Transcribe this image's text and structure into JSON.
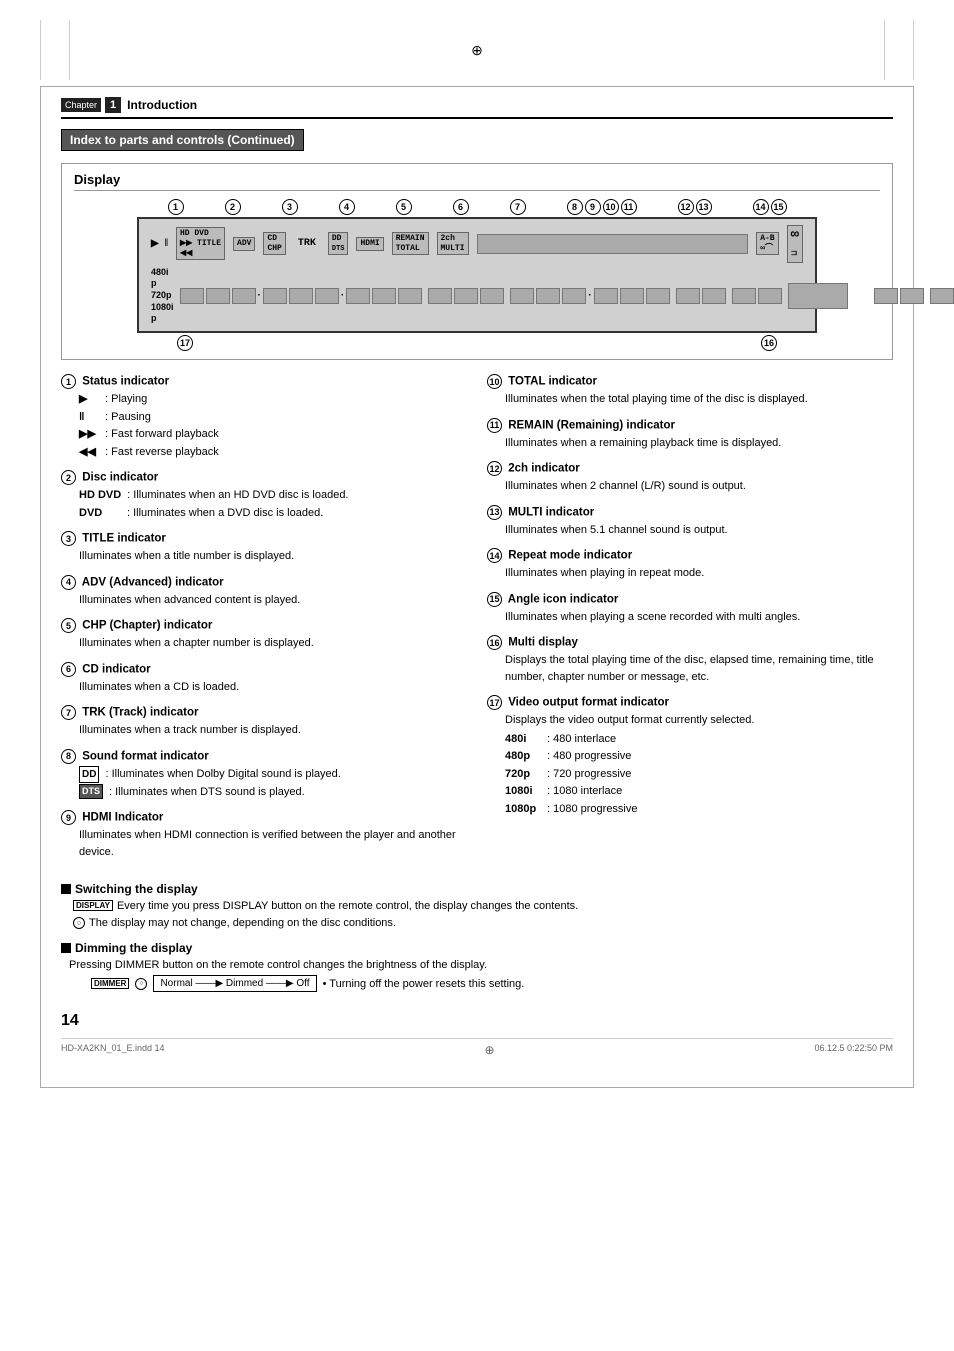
{
  "chapter": {
    "label": "Chapter",
    "number": "1",
    "title": "Introduction"
  },
  "section_title": "Index to parts and controls (Continued)",
  "display_section": {
    "title": "Display",
    "panel": {
      "circled_numbers_top": [
        "①",
        "②",
        "③",
        "④",
        "⑤",
        "⑥",
        "⑦",
        "⑧",
        "⑨",
        "⑩",
        "⑪",
        "⑫",
        "⑬",
        "⑭",
        "⑮"
      ],
      "circled_numbers_bottom": [
        "⑰",
        "⑯"
      ],
      "labels_row1": [
        "▶ ‖  HD DVD",
        "ADV",
        "CD",
        "HDMI  REMAIN",
        "2ch",
        "A-B"
      ],
      "labels_row2": [
        "▶▶   TITLE",
        "",
        "CHP  TRK",
        "DTS  TOTAL  MULTI",
        "",
        "∞"
      ],
      "res_labels": [
        "480i p",
        "720p",
        "1080i p"
      ]
    }
  },
  "indicators": {
    "left": [
      {
        "num": "①",
        "title": "Status indicator",
        "items": [
          {
            "sym": "▶",
            "desc": ": Playing"
          },
          {
            "sym": "‖",
            "desc": ": Pausing"
          },
          {
            "sym": "▶▶",
            "desc": ": Fast forward playback"
          },
          {
            "sym": "◀◀",
            "desc": ": Fast reverse playback"
          }
        ]
      },
      {
        "num": "②",
        "title": "Disc indicator",
        "items": [
          {
            "sym": "HD DVD",
            "desc": ": Illuminates when an HD DVD disc is loaded."
          },
          {
            "sym": "DVD",
            "desc": ": Illuminates when a DVD disc is loaded."
          }
        ]
      },
      {
        "num": "③",
        "title": "TITLE indicator",
        "desc": "Illuminates when a title number is displayed."
      },
      {
        "num": "④",
        "title": "ADV (Advanced) indicator",
        "desc": "Illuminates when advanced content is played."
      },
      {
        "num": "⑤",
        "title": "CHP (Chapter) indicator",
        "desc": "Illuminates when a chapter number is displayed."
      },
      {
        "num": "⑥",
        "title": "CD indicator",
        "desc": "Illuminates when a CD is loaded."
      },
      {
        "num": "⑦",
        "title": "TRK (Track) indicator",
        "desc": "Illuminates when a track number is displayed."
      },
      {
        "num": "⑧",
        "title": "Sound format indicator",
        "items": [
          {
            "sym": "DD",
            "desc": ": Illuminates when Dolby Digital sound is played."
          },
          {
            "sym": "DTS",
            "desc": ": Illuminates when DTS sound is played."
          }
        ]
      },
      {
        "num": "⑨",
        "title": "HDMI Indicator",
        "desc": "Illuminates when HDMI connection is verified between the player and another device."
      }
    ],
    "right": [
      {
        "num": "⑩",
        "title": "TOTAL indicator",
        "desc": "Illuminates when the total playing time of the disc is displayed."
      },
      {
        "num": "⑪",
        "title": "REMAIN (Remaining) indicator",
        "desc": "Illuminates when a remaining playback time is displayed."
      },
      {
        "num": "⑫",
        "title": "2ch indicator",
        "desc": "Illuminates when 2 channel (L/R) sound is output."
      },
      {
        "num": "⑬",
        "title": "MULTI indicator",
        "desc": "Illuminates when 5.1 channel sound is output."
      },
      {
        "num": "⑭",
        "title": "Repeat mode indicator",
        "desc": "Illuminates when playing in repeat mode."
      },
      {
        "num": "⑮",
        "title": "Angle icon indicator",
        "desc": "Illuminates when playing a scene recorded with multi angles."
      },
      {
        "num": "⑯",
        "title": "Multi display",
        "desc": "Displays the total playing time of the disc, elapsed time, remaining time, title number, chapter number or message, etc."
      },
      {
        "num": "⑰",
        "title": "Video output format indicator",
        "desc": "Displays the video output format currently selected.",
        "sub_items": [
          {
            "sym": "480i",
            "desc": ": 480 interlace"
          },
          {
            "sym": "480p",
            "desc": ": 480 progressive"
          },
          {
            "sym": "720p",
            "desc": ": 720 progressive"
          },
          {
            "sym": "1080i",
            "desc": ": 1080 interlace"
          },
          {
            "sym": "1080p",
            "desc": ": 1080 progressive"
          }
        ]
      }
    ]
  },
  "switching_display": {
    "heading": "Switching the display",
    "icon": "DISPLAY",
    "note1": "Every time you press DISPLAY button on the remote control, the display changes the contents.",
    "note2": "The display may not change, depending on the disc conditions."
  },
  "dimming_display": {
    "heading": "Dimming the display",
    "desc": "Pressing DIMMER button on the remote control changes the brightness of the display.",
    "icon": "DIMMER",
    "flow": "Normal ——▶ Dimmed ——▶ Off",
    "note": "• Turning off the power resets this setting."
  },
  "page_num": "14",
  "footer": {
    "left": "HD-XA2KN_01_E.indd  14",
    "right": "06.12.5  0:22:50 PM"
  }
}
